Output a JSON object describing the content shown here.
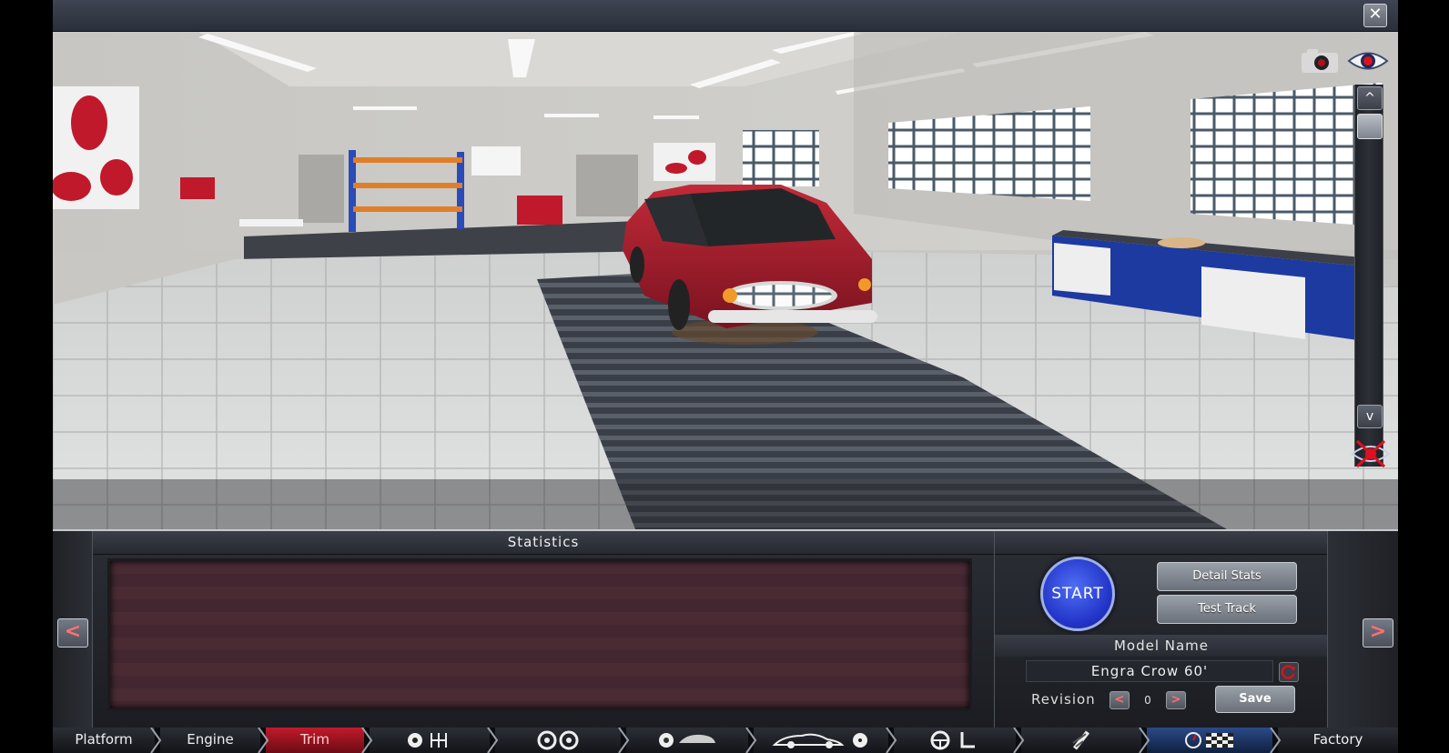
{
  "window": {
    "close_label": "✕"
  },
  "viewport": {
    "icons": [
      "camera-icon",
      "eye-icon",
      "hide-view-icon"
    ],
    "scroll_up_label": "^",
    "scroll_down_label": "v"
  },
  "panel": {
    "prev_label": "<",
    "next_label": ">",
    "statistics_title": "Statistics",
    "start_label": "START",
    "detail_stats_label": "Detail Stats",
    "test_track_label": "Test Track",
    "model_name_label": "Model Name",
    "model_name_value": "Engra Crow 60'",
    "revision_label": "Revision",
    "revision_value": "0",
    "revision_prev_label": "<",
    "revision_next_label": ">",
    "save_label": "Save"
  },
  "tabs": [
    {
      "label": "Platform",
      "active": false
    },
    {
      "label": "Engine",
      "active": false
    },
    {
      "label": "Trim",
      "active": true
    },
    {
      "label": "",
      "icon": "gearbox-icon"
    },
    {
      "label": "",
      "icon": "wheels-icon"
    },
    {
      "label": "",
      "icon": "brakes-icon"
    },
    {
      "label": "",
      "icon": "aero-icon"
    },
    {
      "label": "",
      "icon": "interior-icon"
    },
    {
      "label": "",
      "icon": "suspension-icon"
    },
    {
      "label": "",
      "icon": "testing-icon"
    },
    {
      "label": "Factory",
      "active": false
    }
  ],
  "colors": {
    "accent_red": "#c21a2a",
    "start_blue": "#2234c8",
    "car_red": "#a8192a"
  }
}
